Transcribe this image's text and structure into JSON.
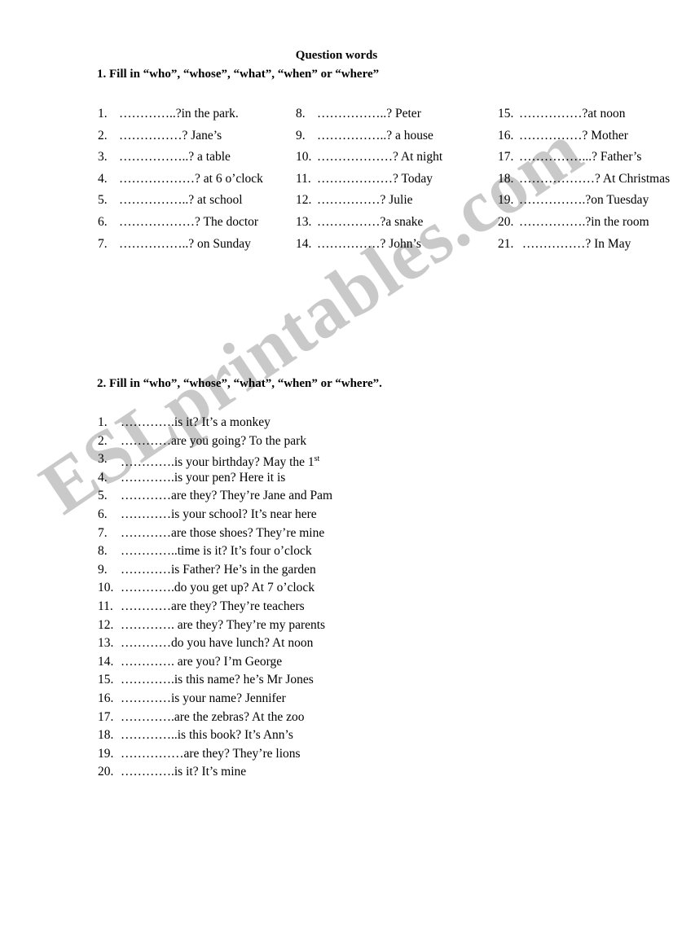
{
  "document": {
    "title": "Question words",
    "watermark": "ESLprintables.com",
    "watermark_color": "#c9c9c9"
  },
  "section1": {
    "heading": "1.  Fill in “who”, “whose”, “what”, “when” or “where”",
    "column1": [
      {
        "num": "1.",
        "text": "…………..?in the park."
      },
      {
        "num": "2.",
        "text": "……………? Jane’s"
      },
      {
        "num": "3.",
        "text": "……………..? a table"
      },
      {
        "num": "4.",
        "text": "………………? at 6 o’clock"
      },
      {
        "num": "5.",
        "text": "……………..? at school"
      },
      {
        "num": "6.",
        "text": "………………? The doctor"
      },
      {
        "num": "7.",
        "text": "……………..? on Sunday"
      }
    ],
    "column2": [
      {
        "num": "8.",
        "text": "……………..? Peter"
      },
      {
        "num": "9.",
        "text": "……………..? a house"
      },
      {
        "num": "10.",
        "text": "………………? At night"
      },
      {
        "num": "11.",
        "text": "………………? Today"
      },
      {
        "num": "12.",
        "text": "……………? Julie"
      },
      {
        "num": "13.",
        "text": "……………?a snake"
      },
      {
        "num": "14.",
        "text": "……………? John’s"
      }
    ],
    "column3": [
      {
        "num": "15.",
        "text": "……………?at noon"
      },
      {
        "num": "16.",
        "text": "……………? Mother"
      },
      {
        "num": "17.",
        "text": "……………...? Father’s"
      },
      {
        "num": "18.",
        "text": "………………? At Christmas"
      },
      {
        "num": "19.",
        "text": "…………….?on Tuesday"
      },
      {
        "num": "20.",
        "text": "…………….?in the room"
      },
      {
        "num": "21.",
        "text": " ……………? In May"
      }
    ]
  },
  "section2": {
    "heading": "2.  Fill in “who”, “whose”, “what”, “when” or “where”.",
    "items": [
      {
        "num": "1.",
        "text": "………….is it? It’s a monkey"
      },
      {
        "num": "2.",
        "text": "…………are you going? To the park"
      },
      {
        "num": "3.",
        "text": "………….is your birthday? May the 1",
        "sup": "st"
      },
      {
        "num": "4.",
        "text": "………….is your pen? Here it is"
      },
      {
        "num": "5.",
        "text": "…………are they? They’re Jane and Pam"
      },
      {
        "num": "6.",
        "text": "…………is your school? It’s near here"
      },
      {
        "num": "7.",
        "text": "…………are those shoes? They’re mine"
      },
      {
        "num": "8.",
        "text": "…………..time is it? It’s four o’clock"
      },
      {
        "num": "9.",
        "text": "…………is Father? He’s in the garden"
      },
      {
        "num": "10.",
        "text": "………….do you get up? At 7 o’clock"
      },
      {
        "num": "11.",
        "text": "…………are they? They’re teachers"
      },
      {
        "num": "12.",
        "text": "…………. are they? They’re my parents"
      },
      {
        "num": "13.",
        "text": "…………do you have lunch? At noon"
      },
      {
        "num": "14.",
        "text": "…………. are you? I’m George"
      },
      {
        "num": "15.",
        "text": "………….is this name? he’s Mr Jones"
      },
      {
        "num": "16.",
        "text": "…………is your name? Jennifer"
      },
      {
        "num": "17.",
        "text": "………….are the zebras? At the zoo"
      },
      {
        "num": "18.",
        "text": "…………..is this book? It’s Ann’s"
      },
      {
        "num": "19.",
        "text": "……………are they? They’re lions"
      },
      {
        "num": "20.",
        "text": "………….is it? It’s mine"
      }
    ]
  }
}
